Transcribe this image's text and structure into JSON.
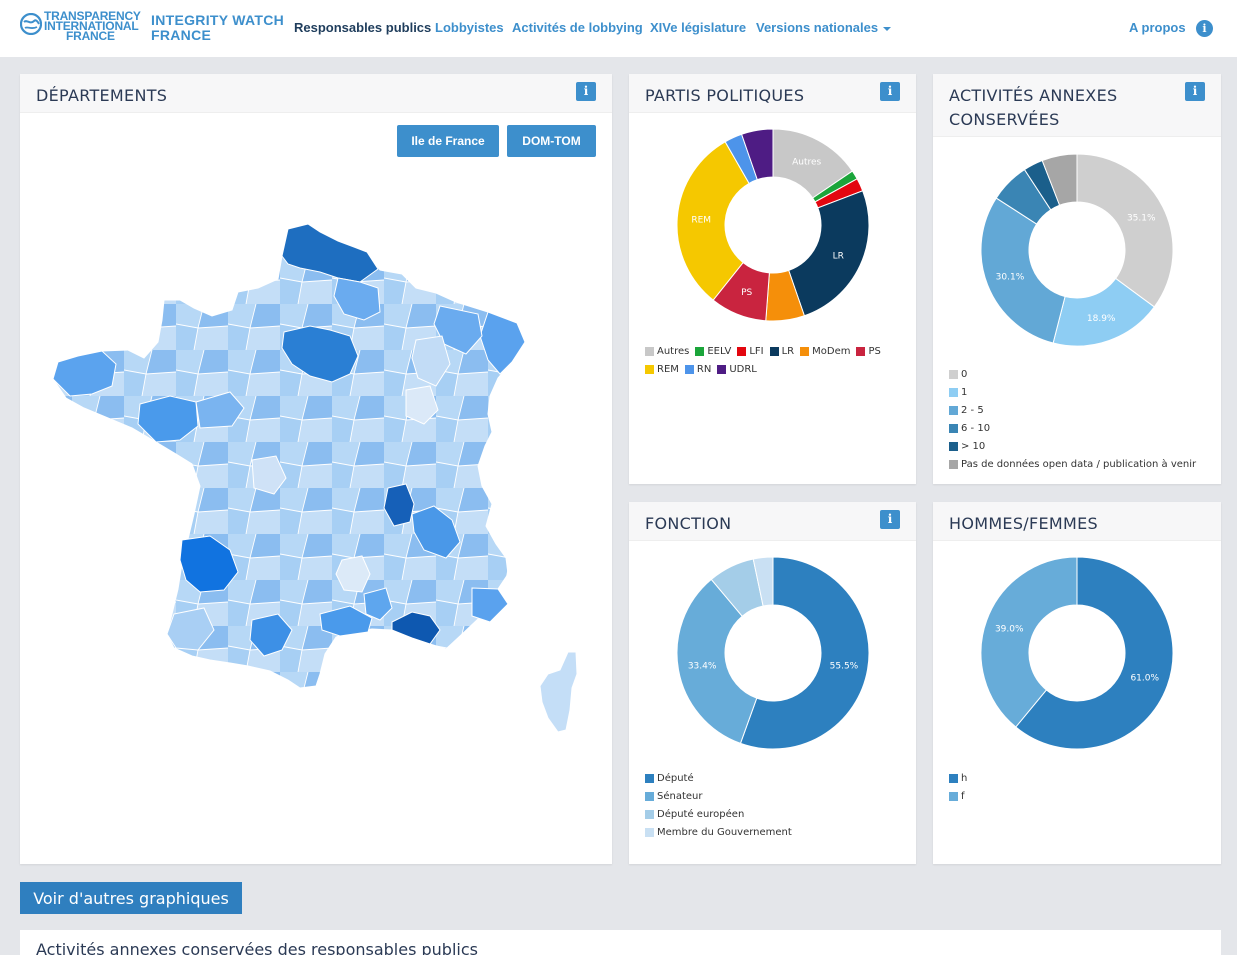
{
  "brand": {
    "ti_lines": [
      "TRANSPARENCY",
      "INTERNATIONAL",
      "FRANCE"
    ],
    "iw_lines": [
      "INTEGRITY WATCH",
      "FRANCE"
    ]
  },
  "nav": {
    "items": [
      "Responsables publics",
      "Lobbyistes",
      "Activités de lobbying",
      "XIVe législature",
      "Versions nationales"
    ],
    "about": "A propos",
    "info": "i"
  },
  "departements": {
    "title": "DÉPARTEMENTS",
    "btn_idf": "Ile de France",
    "btn_domtom": "DOM-TOM",
    "info": "i"
  },
  "partis": {
    "title": "PARTIS POLITIQUES",
    "info": "i",
    "chart_data": {
      "type": "pie",
      "slices": [
        {
          "label": "Autres",
          "value": 15.5,
          "color": "#c8c8c8",
          "shown": "Autres"
        },
        {
          "label": "EELV",
          "value": 1.5,
          "color": "#1ba53a",
          "shown": ""
        },
        {
          "label": "LFI",
          "value": 2.2,
          "color": "#e3060f",
          "shown": ""
        },
        {
          "label": "LR",
          "value": 25.5,
          "color": "#0b3a5e",
          "shown": "LR"
        },
        {
          "label": "MoDem",
          "value": 6.5,
          "color": "#f58f0a",
          "shown": ""
        },
        {
          "label": "PS",
          "value": 9.5,
          "color": "#c9243f",
          "shown": "PS"
        },
        {
          "label": "REM",
          "value": 31.0,
          "color": "#f5c800",
          "shown": "REM"
        },
        {
          "label": "RN",
          "value": 3.0,
          "color": "#4d94ea",
          "shown": ""
        },
        {
          "label": "UDRL",
          "value": 5.3,
          "color": "#4e1c84",
          "shown": ""
        }
      ]
    }
  },
  "annexes": {
    "title_lines": [
      "ACTIVITÉS ANNEXES",
      "CONSERVÉES"
    ],
    "info": "i",
    "chart_data": {
      "type": "pie",
      "slices": [
        {
          "label": "0",
          "value": 35.1,
          "color": "#cfcfcf",
          "shown": "35.1%"
        },
        {
          "label": "1",
          "value": 18.9,
          "color": "#8ecdf3",
          "shown": "18.9%"
        },
        {
          "label": "2 - 5",
          "value": 30.1,
          "color": "#62a8d6",
          "shown": "30.1%"
        },
        {
          "label": "6 - 10",
          "value": 6.7,
          "color": "#3a85b4",
          "shown": ""
        },
        {
          "label": "> 10",
          "value": 3.3,
          "color": "#1b5f8b",
          "shown": ""
        },
        {
          "label": "Pas de données open data / publication à venir",
          "value": 5.9,
          "color": "#a6a6a6",
          "shown": ""
        }
      ]
    }
  },
  "fonction": {
    "title": "FONCTION",
    "info": "i",
    "chart_data": {
      "type": "pie",
      "slices": [
        {
          "label": "Député",
          "value": 55.5,
          "color": "#2d80bf",
          "shown": "55.5%"
        },
        {
          "label": "Sénateur",
          "value": 33.4,
          "color": "#67acd9",
          "shown": "33.4%"
        },
        {
          "label": "Député européen",
          "value": 7.8,
          "color": "#a4cde8",
          "shown": ""
        },
        {
          "label": "Membre du Gouvernement",
          "value": 3.3,
          "color": "#c9e0f3",
          "shown": ""
        }
      ]
    }
  },
  "sexe": {
    "title": "HOMMES/FEMMES",
    "chart_data": {
      "type": "pie",
      "slices": [
        {
          "label": "h",
          "value": 61.0,
          "color": "#2d80bf",
          "shown": "61.0%"
        },
        {
          "label": "f",
          "value": 39.0,
          "color": "#67acd9",
          "shown": "39.0%"
        }
      ]
    }
  },
  "more_button": "Voir d'autres graphiques",
  "bottom_title": "Activités annexes conservées des responsables publics",
  "colors": {
    "accent": "#3d8fcc",
    "dark": "#1f3d5c"
  }
}
